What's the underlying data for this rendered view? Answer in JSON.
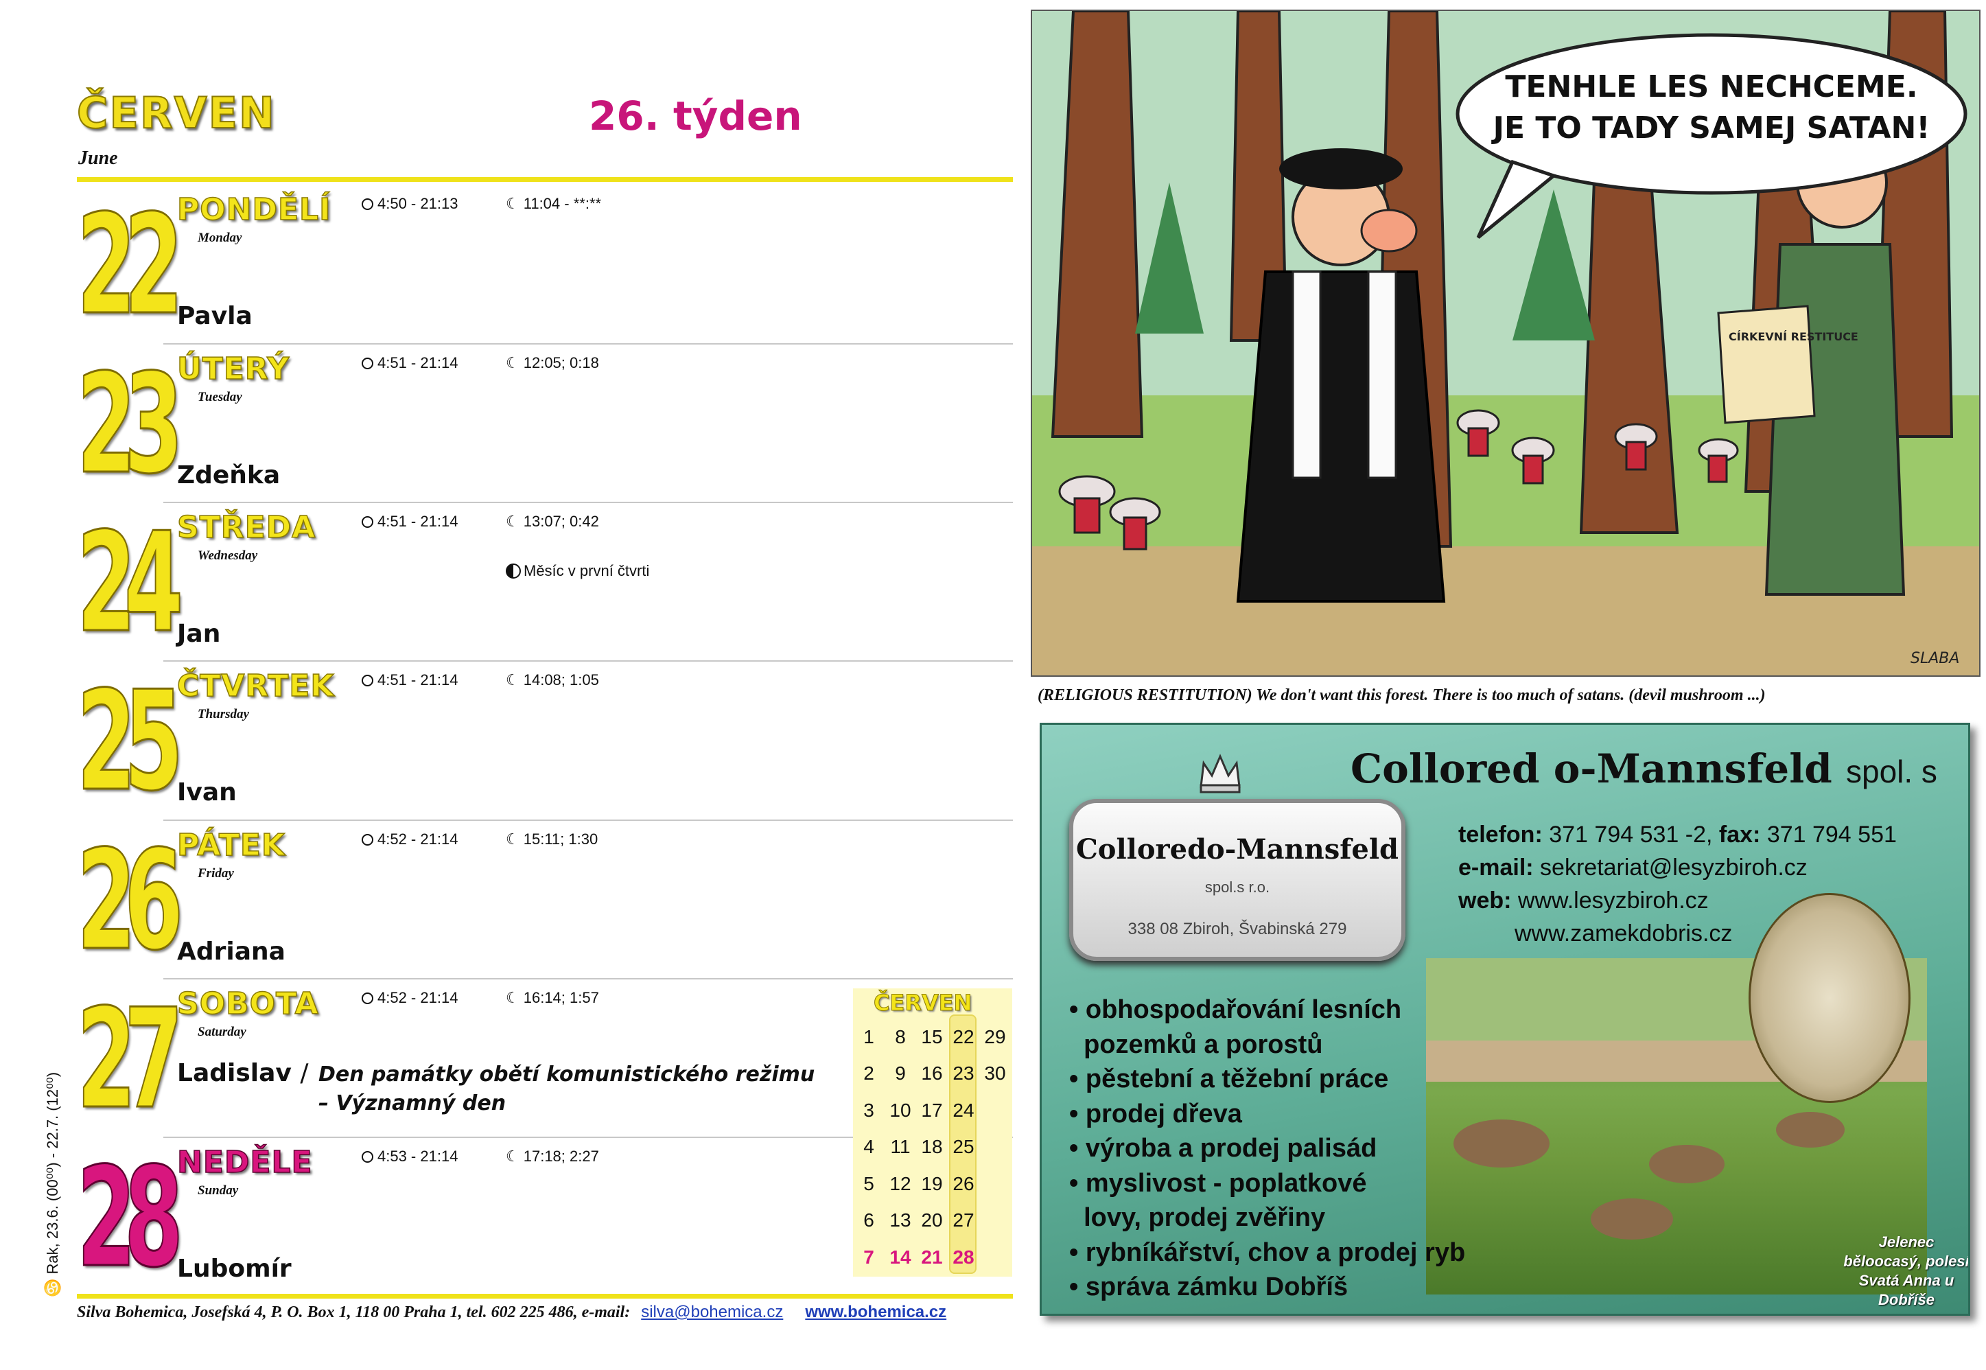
{
  "header": {
    "month": "ČERVEN",
    "month_en": "June",
    "week": "26. týden"
  },
  "days": [
    {
      "num": "22",
      "name": "PONDĚLÍ",
      "name_en": "Monday",
      "sun": "4:50 - 21:13",
      "moon": "11:04 - **:**",
      "nameday": "Pavla"
    },
    {
      "num": "23",
      "name": "ÚTERÝ",
      "name_en": "Tuesday",
      "sun": "4:51 - 21:14",
      "moon": "12:05; 0:18",
      "nameday": "Zdeňka"
    },
    {
      "num": "24",
      "name": "STŘEDA",
      "name_en": "Wednesday",
      "sun": "4:51 - 21:14",
      "moon": "13:07; 0:42",
      "nameday": "Jan",
      "phase": "Měsíc v první čtvrti"
    },
    {
      "num": "25",
      "name": "ČTVRTEK",
      "name_en": "Thursday",
      "sun": "4:51 - 21:14",
      "moon": "14:08; 1:05",
      "nameday": "Ivan"
    },
    {
      "num": "26",
      "name": "PÁTEK",
      "name_en": "Friday",
      "sun": "4:52 - 21:14",
      "moon": "15:11; 1:30",
      "nameday": "Adriana"
    },
    {
      "num": "27",
      "name": "SOBOTA",
      "name_en": "Saturday",
      "sun": "4:52 - 21:14",
      "moon": "16:14; 1:57",
      "nameday": "Ladislav",
      "holiday_line1": "Den památky obětí komunistického režimu",
      "holiday_line2": "– Významný den"
    },
    {
      "num": "28",
      "name": "NEDĚLE",
      "name_en": "Sunday",
      "sun": "4:53 - 21:14",
      "moon": "17:18; 2:27",
      "nameday": "Lubomír"
    }
  ],
  "holiday_separator": "/",
  "side_note": "Rak, 23.6. (00⁰⁰) - 22.7. (12⁰⁰)",
  "minical": {
    "title": "ČERVEN",
    "rows": [
      [
        "1",
        "8",
        "15",
        "22",
        "29"
      ],
      [
        "2",
        "9",
        "16",
        "23",
        "30"
      ],
      [
        "3",
        "10",
        "17",
        "24",
        ""
      ],
      [
        "4",
        "11",
        "18",
        "25",
        ""
      ],
      [
        "5",
        "12",
        "19",
        "26",
        ""
      ],
      [
        "6",
        "13",
        "20",
        "27",
        ""
      ],
      [
        "7",
        "14",
        "21",
        "28",
        ""
      ]
    ]
  },
  "footer": {
    "text": "Silva Bohemica, Josefská 4, P. O. Box 1, 118 00 Praha 1, tel. 602 225 486, e-mail:",
    "email": "silva@bohemica.cz",
    "web": "www.bohemica.cz"
  },
  "cartoon": {
    "bubble_line1": "TENHLE LES NECHCEME.",
    "bubble_line2": "JE TO TADY SAMEJ SATAN!",
    "paper_text": "CÍRKEVNÍ RESTITUCE",
    "signature": "SLABA",
    "caption": "(RELIGIOUS RESTITUTION) We don't want this forest. There is too much of satans. (devil mushroom ...)"
  },
  "ad": {
    "brand": "Collored o-Mannsfeld",
    "brand_suffix": "spol. s r.o.",
    "logo_name": "Colloredo-Mannsfeld",
    "logo_sub": "spol.s r.o.",
    "logo_addr": "338 08 Zbiroh, Švabinská 279",
    "phone_label": "telefon:",
    "phone": "371 794 531 -2,",
    "fax_label": "fax:",
    "fax": "371 794 551",
    "email_label": "e-mail:",
    "email": "sekretariat@lesyzbiroh.cz",
    "web_label": "web:",
    "web1": "www.lesyzbiroh.cz",
    "web2": "www.zamekdobris.cz",
    "services": [
      "• obhospodařování lesních",
      "  pozemků a porostů",
      "• pěstební a těžební práce",
      "• prodej dřeva",
      "• výroba a prodej palisád",
      "• myslivost - poplatkové",
      "  lovy, prodej zvěřiny",
      "• rybníkářství, chov a prodej ryb",
      "• správa zámku Dobříš"
    ],
    "photo_caption": "Jelenec běloocasý, polesí Svatá Anna u Dobříše"
  },
  "colors": {
    "accent_yellow": "#f3e41a",
    "accent_magenta": "#d8167e",
    "link_blue": "#1f3fb8",
    "ad_green": "#5fae98"
  }
}
